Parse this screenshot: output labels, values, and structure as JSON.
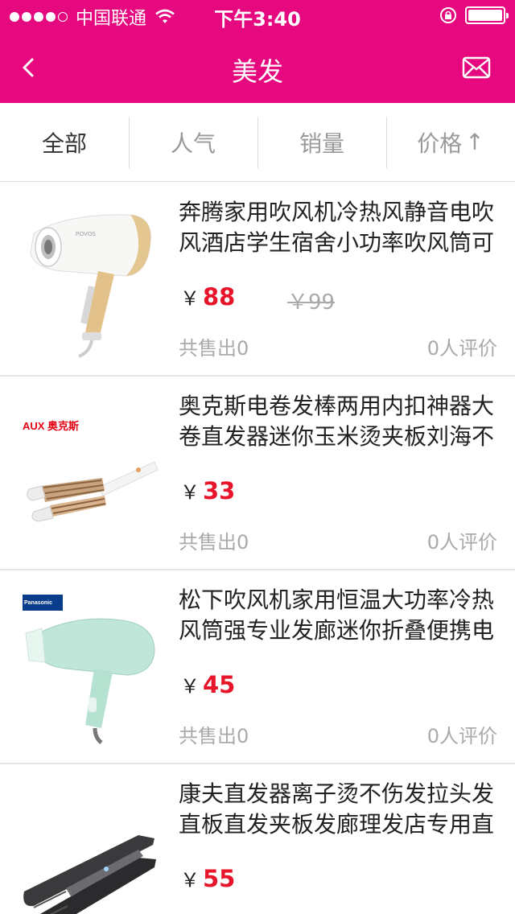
{
  "status_bar": {
    "carrier": "中国联通",
    "time": "下午3:40"
  },
  "nav": {
    "title": "美发",
    "back_icon": "chevron-left-icon",
    "mail_icon": "mail-icon"
  },
  "tabs": [
    {
      "label": "全部",
      "active": true
    },
    {
      "label": "人气",
      "active": false
    },
    {
      "label": "销量",
      "active": false
    },
    {
      "label": "价格",
      "active": false,
      "arrow": "↑"
    }
  ],
  "currency": "￥",
  "products": [
    {
      "title": "奔腾家用吹风机冷热风静音电吹风酒店学生宿舍小功率吹风筒可",
      "price": "88",
      "old_price": "￥99",
      "sold": "共售出0",
      "reviews": "0人评价",
      "brand": "POVOS"
    },
    {
      "title": "奥克斯电卷发棒两用内扣神器大卷直发器迷你玉米烫夹板刘海不",
      "price": "33",
      "sold": "共售出0",
      "reviews": "0人评价",
      "brand": "AUX 奥克斯"
    },
    {
      "title": "松下吹风机家用恒温大功率冷热风筒强专业发廊迷你折叠便携电",
      "price": "45",
      "sold": "共售出0",
      "reviews": "0人评价",
      "brand": "Panasonic"
    },
    {
      "title": "康夫直发器离子烫不伤发拉头发直板直发夹板发廊理发店专用直",
      "price": "55"
    }
  ],
  "colors": {
    "brand": "#e5087f",
    "price": "#e8142a"
  }
}
